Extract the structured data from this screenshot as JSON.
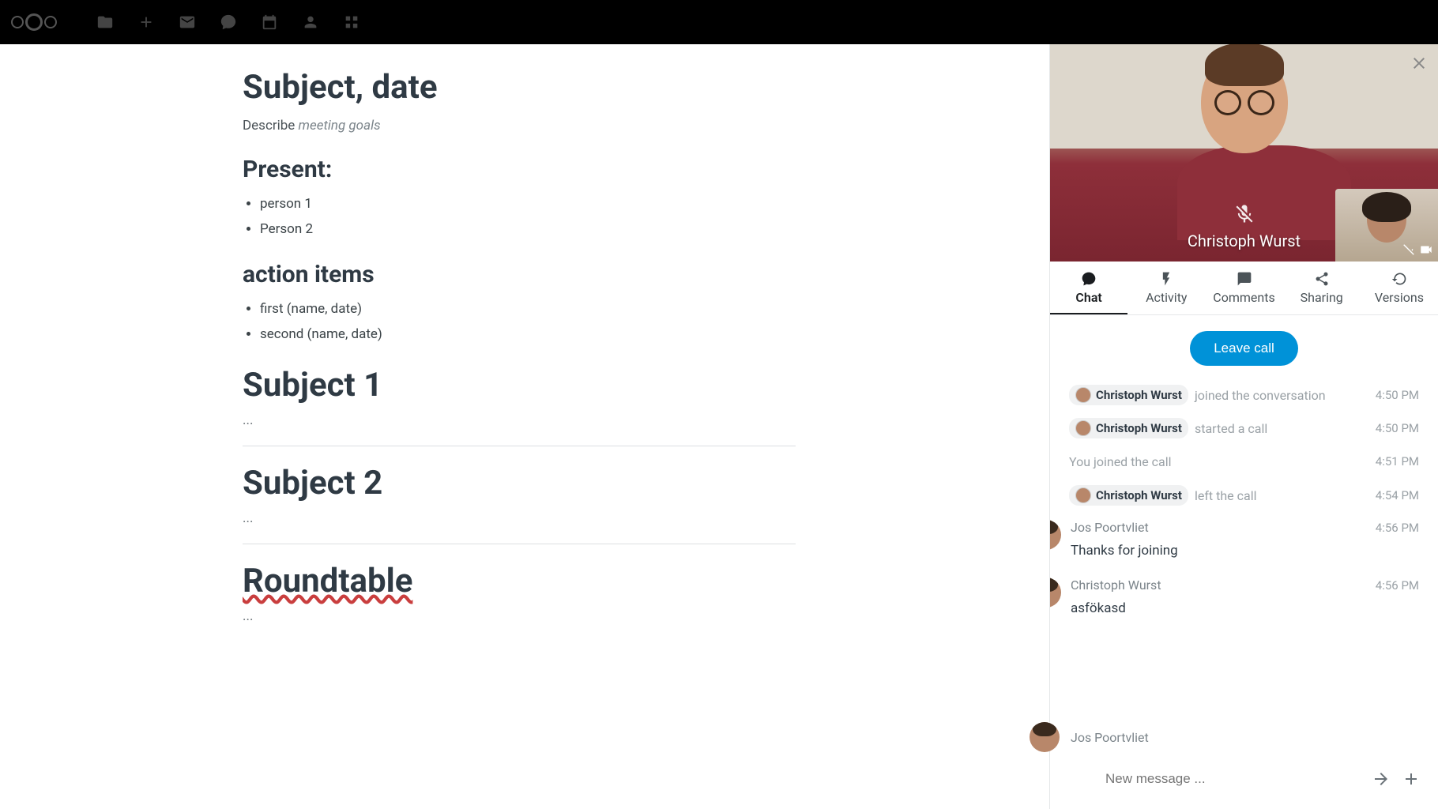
{
  "document": {
    "title": "Subject, date",
    "describe_label": "Describe",
    "describe_hint": "meeting goals",
    "present_heading": "Present:",
    "present": [
      "person 1",
      "Person 2"
    ],
    "action_heading": "action items",
    "action_items": [
      "first (name, date)",
      "second (name, date)"
    ],
    "subject1_heading": "Subject 1",
    "subject1_body": "...",
    "subject2_heading": "Subject 2",
    "subject2_body": "...",
    "roundtable_heading": "Roundtable",
    "roundtable_body": "..."
  },
  "video": {
    "caller_name": "Christoph Wurst"
  },
  "tabs": {
    "chat": "Chat",
    "activity": "Activity",
    "comments": "Comments",
    "sharing": "Sharing",
    "versions": "Versions"
  },
  "leave_call_label": "Leave call",
  "chat": {
    "events": [
      {
        "type": "sys_pill",
        "user": "Christoph Wurst",
        "text": "joined the conversation",
        "time": "4:50 PM"
      },
      {
        "type": "sys_pill",
        "user": "Christoph Wurst",
        "text": "started a call",
        "time": "4:50 PM"
      },
      {
        "type": "sys_plain",
        "text": "You joined the call",
        "time": "4:51 PM"
      },
      {
        "type": "sys_pill",
        "user": "Christoph Wurst",
        "text": "left the call",
        "time": "4:54 PM"
      },
      {
        "type": "msg",
        "author": "Jos Poortvliet",
        "time": "4:56 PM",
        "body": "Thanks for joining"
      },
      {
        "type": "msg",
        "author": "Christoph Wurst",
        "time": "4:56 PM",
        "body": "asfökasd"
      }
    ],
    "compose_user": "Jos Poortvliet",
    "compose_placeholder": "New message ..."
  }
}
